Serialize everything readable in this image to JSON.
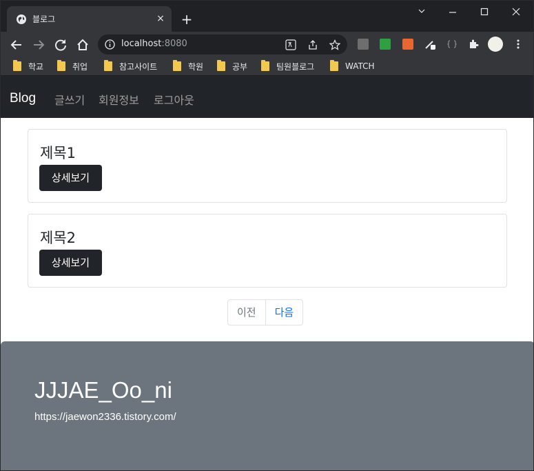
{
  "browser": {
    "tab_title": "블로그",
    "tab_close": "×",
    "new_tab": "+",
    "url_host": "localhost",
    "url_port": ":8080",
    "bookmarks": [
      {
        "label": "학교"
      },
      {
        "label": "취업"
      },
      {
        "label": "참고사이트"
      },
      {
        "label": "학원"
      },
      {
        "label": "공부"
      },
      {
        "label": "팀원블로그"
      },
      {
        "label": "WATCH"
      }
    ],
    "icons": [
      "globe-icon",
      "back-icon",
      "forward-icon",
      "reload-icon",
      "home-icon",
      "info-icon",
      "translate-icon",
      "share-icon",
      "star-icon",
      "extensions-icon",
      "profile-icon",
      "menu-icon"
    ]
  },
  "navbar": {
    "brand": "Blog",
    "links": [
      {
        "label": "글쓰기"
      },
      {
        "label": "회원정보"
      },
      {
        "label": "로그아웃"
      }
    ]
  },
  "posts": [
    {
      "title": "제목1",
      "button": "상세보기"
    },
    {
      "title": "제목2",
      "button": "상세보기"
    }
  ],
  "pagination": {
    "prev": "이전",
    "next": "다음"
  },
  "footer": {
    "title": "JJJAE_Oo_ni",
    "link": "https://jaewon2336.tistory.com/"
  },
  "colors": {
    "navbar_bg": "#212529",
    "footer_bg": "#6c757d",
    "link_blue": "#0d6efd"
  }
}
